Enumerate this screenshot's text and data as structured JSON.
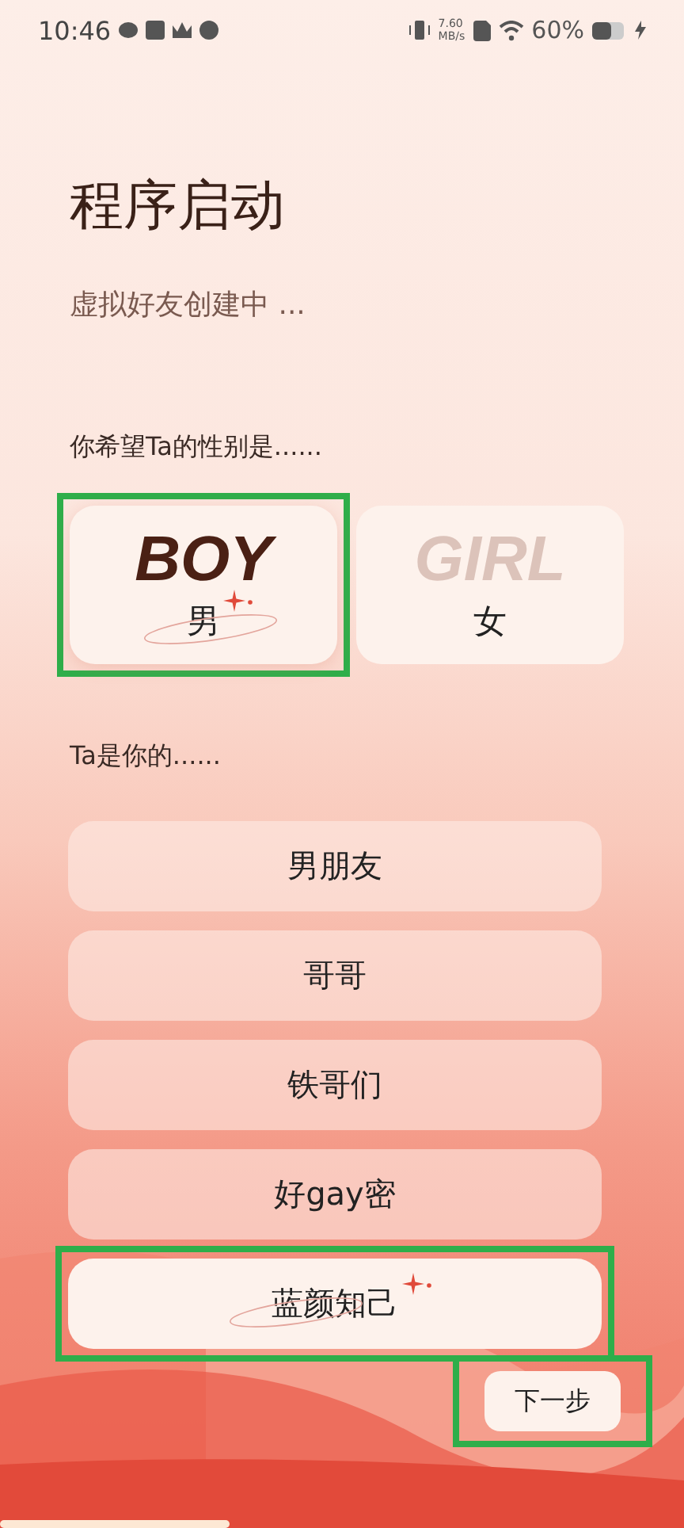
{
  "status_bar": {
    "time": "10:46",
    "speed": "7.60",
    "speed_unit": "MB/s",
    "battery": "60%"
  },
  "title": "程序启动",
  "subtitle": "虚拟好友创建中 ...",
  "gender_prompt": "你希望Ta的性别是......",
  "genders": [
    {
      "tag": "BOY",
      "label": "男",
      "selected": true,
      "highlighted": true
    },
    {
      "tag": "GIRL",
      "label": "女",
      "selected": false,
      "highlighted": false
    }
  ],
  "relation_prompt": "Ta是你的......",
  "relations": [
    {
      "label": "男朋友",
      "selected": false,
      "highlighted": false
    },
    {
      "label": "哥哥",
      "selected": false,
      "highlighted": false
    },
    {
      "label": "铁哥们",
      "selected": false,
      "highlighted": false
    },
    {
      "label": "好gay密",
      "selected": false,
      "highlighted": false
    },
    {
      "label": "蓝颜知己",
      "selected": true,
      "highlighted": true
    }
  ],
  "next_button": {
    "label": "下一步",
    "highlighted": true
  }
}
